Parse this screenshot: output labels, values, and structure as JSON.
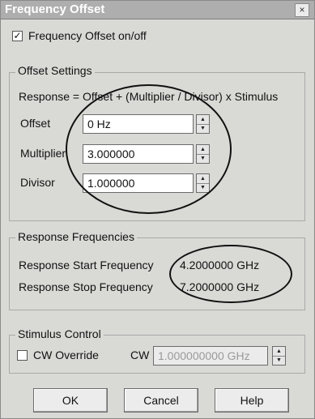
{
  "window": {
    "title": "Frequency Offset",
    "close_glyph": "×"
  },
  "enable": {
    "label": "Frequency Offset on/off",
    "checked": true,
    "check_glyph": "✓"
  },
  "offset_settings": {
    "title": "Offset Settings",
    "formula": "Response  =  Offset + (Multiplier / Divisor) x Stimulus",
    "offset": {
      "label": "Offset",
      "value": "0 Hz"
    },
    "multiplier": {
      "label": "Multiplier",
      "value": "3.000000"
    },
    "divisor": {
      "label": "Divisor",
      "value": "1.000000"
    }
  },
  "response_frequencies": {
    "title": "Response Frequencies",
    "start": {
      "label": "Response Start Frequency",
      "value": "4.2000000 GHz"
    },
    "stop": {
      "label": "Response Stop Frequency",
      "value": "7.2000000 GHz"
    }
  },
  "stimulus_control": {
    "title": "Stimulus Control",
    "cw_override": {
      "label": "CW Override",
      "checked": false
    },
    "cw": {
      "label": "CW",
      "value": "1.000000000 GHz",
      "disabled": true
    }
  },
  "buttons": {
    "ok": "OK",
    "cancel": "Cancel",
    "help": "Help"
  },
  "spinner_glyphs": {
    "up": "▲",
    "down": "▼"
  }
}
